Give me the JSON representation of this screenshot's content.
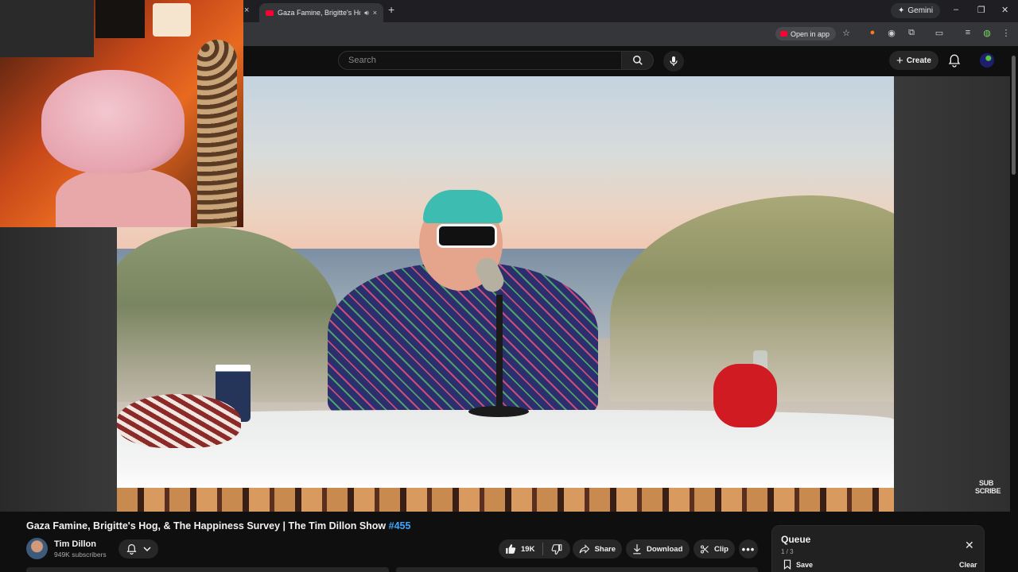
{
  "browser": {
    "tab_title": "Gaza Famine, Brigitte's Hog",
    "new_tab": "+",
    "gemini_label": "Gemini",
    "open_in_app_label": "Open in app",
    "tab_close": "×",
    "window": {
      "minimize": "–",
      "restore": "❐",
      "close": "✕"
    }
  },
  "header": {
    "search_placeholder": "Search",
    "create_label": "Create"
  },
  "video": {
    "title_main": "Gaza Famine, Brigitte's Hog, & The Happiness Survey | The Tim Dillon Show ",
    "title_hashtag": "#455",
    "subscribe_badge_line1": "SUB",
    "subscribe_badge_line2": "SCRIBE"
  },
  "channel": {
    "name": "Tim Dillon",
    "subscribers": "949K subscribers"
  },
  "actions": {
    "likes": "19K",
    "share": "Share",
    "download": "Download",
    "clip": "Clip"
  },
  "queue": {
    "title": "Queue",
    "count": "1 / 3",
    "save": "Save",
    "clear": "Clear"
  },
  "colors": {
    "accent_red": "#ff0033",
    "link_blue": "#3ea6ff",
    "background": "#0f0f0f"
  }
}
